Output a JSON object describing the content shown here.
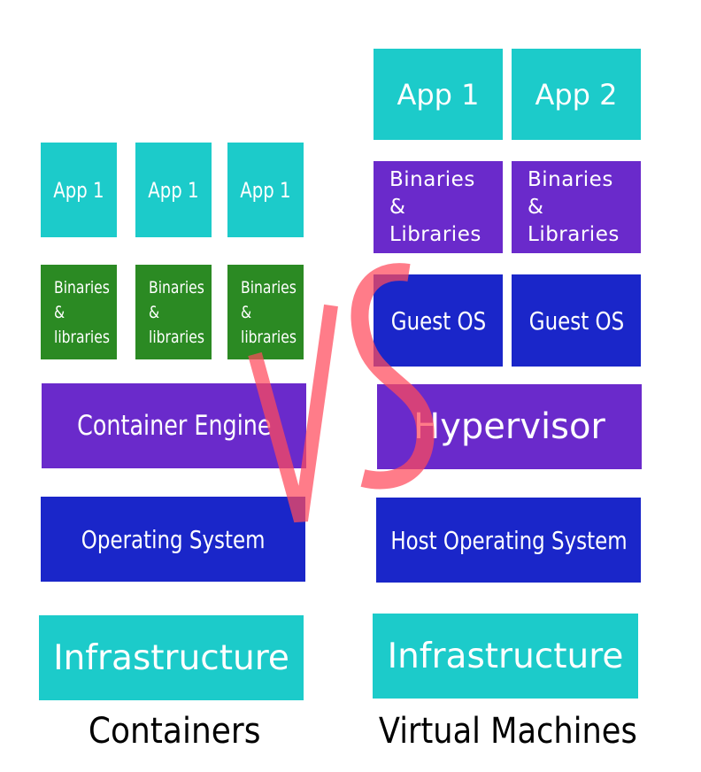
{
  "containers": {
    "caption": "Containers",
    "apps": [
      {
        "label": "App 1"
      },
      {
        "label": "App 1"
      },
      {
        "label": "App 1"
      }
    ],
    "libs": [
      {
        "line1": "Binaries",
        "line2": "&",
        "line3": "libraries"
      },
      {
        "line1": "Binaries",
        "line2": "&",
        "line3": "libraries"
      },
      {
        "line1": "Binaries",
        "line2": "&",
        "line3": "libraries"
      }
    ],
    "engine": "Container Engine",
    "os": "Operating System",
    "infra": "Infrastructure"
  },
  "vms": {
    "caption": "Virtual Machines",
    "apps": [
      {
        "label": "App 1"
      },
      {
        "label": "App 2"
      }
    ],
    "libs": [
      {
        "line1": "Binaries",
        "line2": "&",
        "line3": "Libraries"
      },
      {
        "line1": "Binaries",
        "line2": "&",
        "line3": "Libraries"
      }
    ],
    "guest_os": [
      {
        "label": "Guest OS"
      },
      {
        "label": "Guest OS"
      }
    ],
    "hypervisor": "Hypervisor",
    "host_os": "Host Operating System",
    "infra": "Infrastructure"
  },
  "overlay": {
    "text": "VS",
    "color": "#ff4b5c"
  },
  "colors": {
    "app": "#1ccbca",
    "container_libs": "#2b8a23",
    "vm_libs": "#6a2acb",
    "engine": "#6a2acb",
    "os": "#1a26c9"
  }
}
